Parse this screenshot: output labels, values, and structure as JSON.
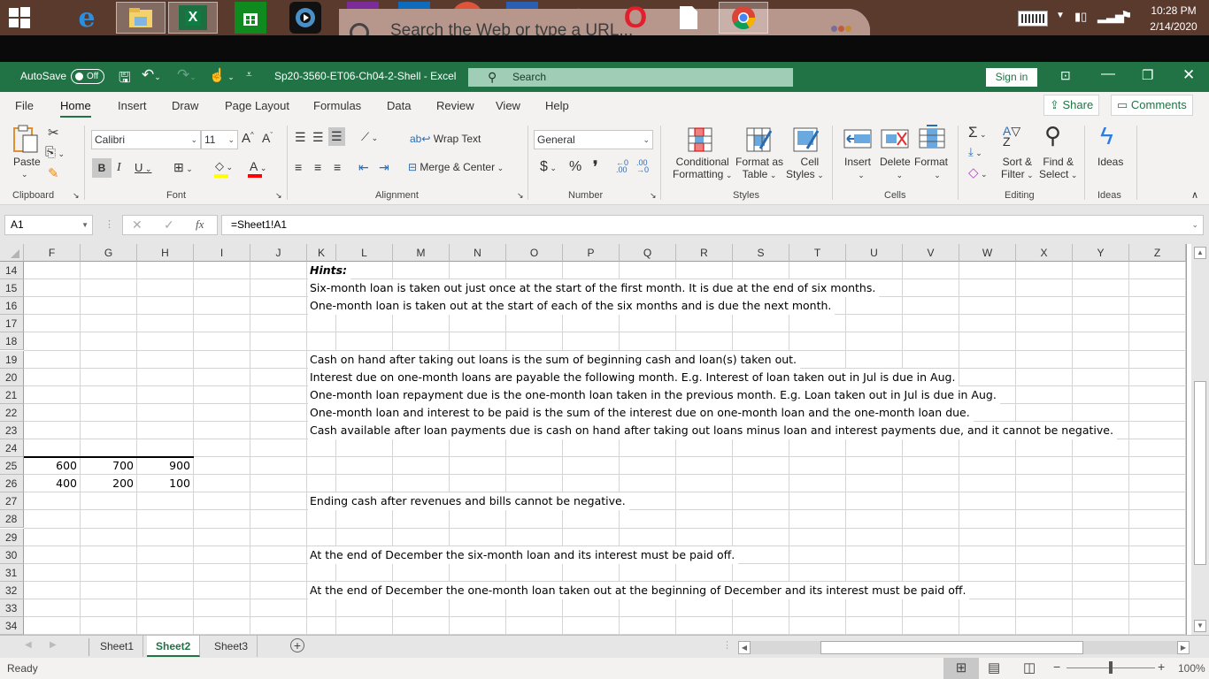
{
  "taskbar": {
    "apps": [
      {
        "name": "start",
        "glyph": "⊞"
      },
      {
        "name": "internet-explorer",
        "glyph": "e"
      },
      {
        "name": "file-explorer",
        "glyph": "📁"
      },
      {
        "name": "excel",
        "glyph": "X"
      },
      {
        "name": "store",
        "glyph": "⊞"
      },
      {
        "name": "media-player",
        "glyph": "▶"
      },
      {
        "name": "onenote",
        "glyph": "N"
      },
      {
        "name": "outlook",
        "glyph": "O"
      },
      {
        "name": "powerpoint",
        "glyph": "P"
      },
      {
        "name": "word",
        "glyph": "W"
      },
      {
        "name": "helm-app",
        "glyph": "⎈"
      },
      {
        "name": "opera",
        "glyph": "O"
      },
      {
        "name": "blank-document",
        "glyph": ""
      },
      {
        "name": "chrome",
        "glyph": "◉"
      }
    ],
    "search_placeholder": "Search the Web or type a URL...",
    "clock_time": "10:28 PM",
    "clock_date": "2/14/2020"
  },
  "titlebar": {
    "autosave_label": "AutoSave",
    "autosave_state": "Off",
    "doc_title": "Sp20-3560-ET06-Ch04-2-Shell  -  Excel",
    "search_label": "Search",
    "sign_in": "Sign in"
  },
  "menu": {
    "items": [
      "File",
      "Home",
      "Insert",
      "Draw",
      "Page Layout",
      "Formulas",
      "Data",
      "Review",
      "View",
      "Help"
    ],
    "active": "Home",
    "share": "Share",
    "comments": "Comments"
  },
  "ribbon": {
    "clipboard": {
      "paste": "Paste",
      "label": "Clipboard"
    },
    "font": {
      "name": "Calibri",
      "size": "11",
      "label": "Font",
      "bold": "B",
      "italic": "I",
      "underline": "U",
      "grow": "A^",
      "shrink": "Aˇ",
      "fill_color": "#ffff00",
      "font_color": "#ff0000"
    },
    "alignment": {
      "wrap": "Wrap Text",
      "merge": "Merge & Center",
      "label": "Alignment"
    },
    "number": {
      "format": "General",
      "currency": "$",
      "percent": "%",
      "comma": "❜",
      "label": "Number"
    },
    "styles": {
      "conditional": "Conditional",
      "conditional2": "Formatting",
      "format_table": "Format as",
      "format_table2": "Table",
      "cell_styles": "Cell",
      "cell_styles2": "Styles",
      "label": "Styles"
    },
    "cells": {
      "insert": "Insert",
      "delete": "Delete",
      "format": "Format",
      "label": "Cells"
    },
    "editing": {
      "sort": "Sort &",
      "sort2": "Filter",
      "find": "Find &",
      "find2": "Select",
      "label": "Editing"
    },
    "ideas": {
      "button": "Ideas",
      "label": "Ideas"
    }
  },
  "formula_bar": {
    "name_box": "A1",
    "formula": "=Sheet1!A1"
  },
  "grid": {
    "columns": [
      "F",
      "G",
      "H",
      "I",
      "J",
      "K",
      "L",
      "M",
      "N",
      "O",
      "P",
      "Q",
      "R",
      "S",
      "T",
      "U",
      "V",
      "W",
      "X",
      "Y",
      "Z"
    ],
    "rows": [
      "14",
      "15",
      "16",
      "17",
      "18",
      "19",
      "20",
      "21",
      "22",
      "23",
      "24",
      "25",
      "26",
      "27",
      "28",
      "29",
      "30",
      "31",
      "32",
      "33",
      "34"
    ],
    "hints_title": "Hints:",
    "hints": {
      "15": "Six-month loan is taken out just once at the start of the first month.  It is due at the end of six months.",
      "16": "One-month loan is taken out at the start of each of the six months and is due the next month.",
      "19": "Cash on hand after taking out loans is the sum of beginning cash and loan(s) taken out.",
      "20": "Interest due on one-month loans are payable the following month.  E.g. Interest of loan taken out in Jul is due in Aug.",
      "21": "One-month loan repayment due is the one-month loan taken in the previous month.  E.g. Loan taken out in Jul is due in Aug.",
      "22": "One-month loan and interest to be paid is the sum of the interest due on one-month loan and the one-month loan due.",
      "23": "Cash available after loan payments due is cash on hand after taking out loans minus loan and interest payments due, and it cannot be negative.",
      "27": "Ending cash after revenues and bills cannot be negative.",
      "30": "At the end of December the six-month loan and its interest must be paid off.",
      "32": "At the end of December the one-month loan taken out at the beginning of December and its interest must be paid off."
    },
    "values": {
      "row25": [
        "600",
        "700",
        "900"
      ],
      "row26": [
        "400",
        "200",
        "100"
      ]
    }
  },
  "sheets": {
    "tabs": [
      "Sheet1",
      "Sheet2",
      "Sheet3"
    ],
    "active": "Sheet2"
  },
  "status": {
    "mode": "Ready",
    "zoom": "100%"
  }
}
